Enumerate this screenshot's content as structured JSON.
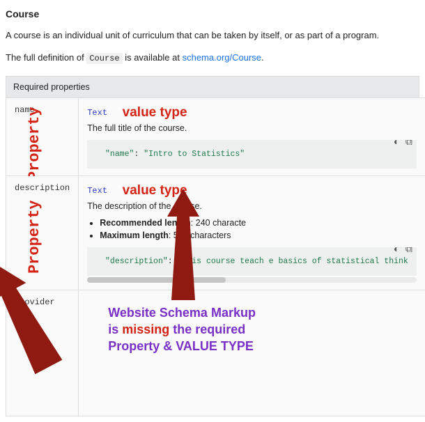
{
  "heading": "Course",
  "intro": "A course is an individual unit of curriculum that can be taken by itself, or as part of a program.",
  "definition_prefix": "The full definition of ",
  "definition_code": "Course",
  "definition_mid": " is available at ",
  "definition_link_text": "schema.org/Course",
  "definition_suffix": ".",
  "section_header": "Required properties",
  "rows": {
    "name": {
      "prop": "name",
      "vtype": "Text",
      "desc": "The full title of the course.",
      "code_key": "\"name\"",
      "code_sep": ": ",
      "code_val": "\"Intro to Statistics\""
    },
    "description": {
      "prop": "description",
      "vtype": "Text",
      "desc": "The description of the course.",
      "bullet1_label": "Recommended length",
      "bullet1_val": ": 240 characte",
      "bullet2_label": "Maximum length",
      "bullet2_val": ": 500 characters",
      "code_key": "\"description\"",
      "code_sep": ": ",
      "code_val": "\"This course teach     e basics of statistical think"
    },
    "provider": {
      "prop": "provider"
    }
  },
  "annotations": {
    "value_type": "value type",
    "property": "Property",
    "missing_line1a": "Website Schema Markup",
    "missing_line2a": "is ",
    "missing_line2b": "missing",
    "missing_line2c": " the required",
    "missing_line3": "Property & VALUE TYPE"
  },
  "icons": {
    "theme": "◐",
    "copy": "⧉"
  }
}
